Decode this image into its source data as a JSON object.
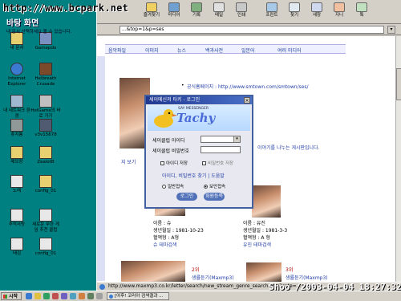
{
  "overlay": {
    "watermark": "http://www.bcpark.net",
    "desktop_title": "바탕 화면",
    "desktop_subtitle": "내 문서 선택하세요 볼 수 있습니다.",
    "datestamp": "Shoo /2003-04-04 18:27:32"
  },
  "browser": {
    "toolbar": [
      {
        "label": "즐겨찾기"
      },
      {
        "label": "미디어"
      },
      {
        "label": "기록"
      },
      {
        "label": "메일"
      },
      {
        "label": "인쇄"
      },
      {
        "label": "프린트"
      },
      {
        "label": "찾기"
      },
      {
        "label": "새창"
      },
      {
        "label": "지니"
      },
      {
        "label": "톡"
      }
    ],
    "address_value": "...&top=1&p=ses",
    "address_go": "▾",
    "status_url": "http://www.maxmp3.co.kr/letter/search/new_stream_genre_search.htm?cate=..."
  },
  "page": {
    "menu": [
      "음악파일",
      "이미지",
      "뉴스",
      "백과사전",
      "일본어",
      "여러 미디어"
    ],
    "bullet1": "공식홈페이지 : http://www.smtown.com/smtown/ses/",
    "note": "이야기를 나누는 게시판입니다.",
    "left_link": "지 보기",
    "artist1": {
      "name": "이름 : 슈",
      "birth": "생년월일 : 1981-10-23",
      "blood": "혈액형 : A형",
      "link": "슈 테마검색"
    },
    "artist2": {
      "name": "이름 : 유진",
      "birth": "생년월일 : 1981-3-3",
      "blood": "혈액형 : A 형",
      "link": "유진 테마검색"
    },
    "rank2": "2위",
    "rank3": "3위",
    "song2": "생률듣기(Maxmp3)",
    "song3": "생률듣기(Maxmp3)"
  },
  "dialog": {
    "title": "세이메신저 타키 - 로그인",
    "close": "×",
    "tagline": "SAY MESSENGER",
    "logo": "Tachy",
    "id_label": "세이클럽 아이디",
    "pw_label": "세이클럽 비밀번호",
    "save_id": "아이디 저장",
    "save_pw": "비밀번호 저장",
    "links": "아이디, 비밀번호 찾기 | 도움말",
    "radio_normal": "일반접속",
    "radio_secure": "보안접속",
    "login_btn": "로그인",
    "join_btn": "회원등록"
  },
  "desktop_icons": [
    {
      "label": "내 문서"
    },
    {
      "label": "Gamepdo"
    },
    {
      "label": "Internet Explorer"
    },
    {
      "label": "Helbreath Crusade"
    },
    {
      "label": "내 네트워크 환경"
    },
    {
      "label": "HelGame의 바로 가기"
    },
    {
      "label": "휴지통"
    },
    {
      "label": "v3v15678"
    },
    {
      "label": "메모장"
    },
    {
      "label": "ZealotB"
    },
    {
      "label": "노래"
    },
    {
      "label": "config_01"
    },
    {
      "label": "추억사랑"
    },
    {
      "label": "새로운 무한 게임 추천 클럽"
    },
    {
      "label": "태김"
    },
    {
      "label": "config_01"
    }
  ],
  "taskbar": {
    "start": "시작",
    "task": "[야후! 코리아 검색결과 ..."
  },
  "colors": {
    "desktop": "#008080",
    "accent": "#203890",
    "link": "#2540a8"
  }
}
